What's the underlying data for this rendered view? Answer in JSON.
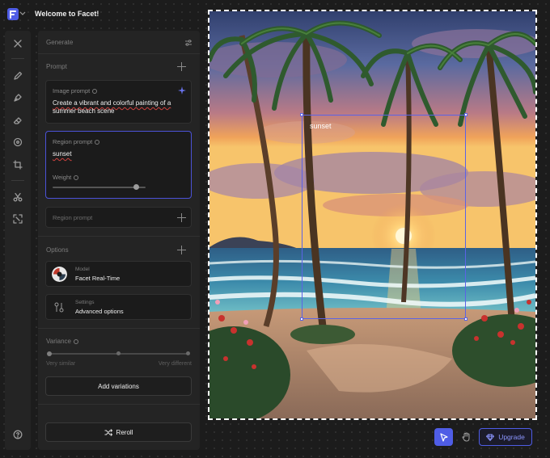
{
  "app": {
    "title": "Welcome to Facet!"
  },
  "toolbar": {
    "tools": [
      "close-icon",
      "pencil-icon",
      "pen-icon",
      "eraser-icon",
      "target-icon",
      "crop-icon",
      "scissors-icon",
      "expand-icon",
      "help-icon"
    ]
  },
  "panel": {
    "header": "Generate",
    "prompt_section": "Prompt",
    "image_prompt": {
      "label": "Image prompt",
      "text_line1": "Create a vibrant and colorful painting of a",
      "text_line2": "summer beach scene"
    },
    "region_prompt": {
      "label": "Region prompt",
      "text": "sunset",
      "weight_label": "Weight",
      "weight_value": 0.9
    },
    "region_prompt_add": "Region prompt",
    "options_section": "Options",
    "model": {
      "label": "Model",
      "value": "Facet Real-Time"
    },
    "settings": {
      "label": "Settings",
      "value": "Advanced options"
    },
    "variance": {
      "label": "Variance",
      "min_label": "Very similar",
      "max_label": "Very different"
    },
    "add_variations": "Add variations",
    "reroll": "Reroll"
  },
  "canvas": {
    "region_label": "sunset"
  },
  "controls": {
    "upgrade": "Upgrade"
  },
  "colors": {
    "accent": "#4f5de6",
    "background": "#1c1c1c",
    "panel": "#242424"
  }
}
